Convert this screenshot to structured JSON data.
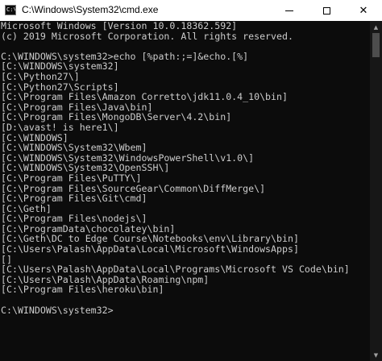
{
  "window": {
    "title": "C:\\Windows\\System32\\cmd.exe",
    "icon_label": "C:\\."
  },
  "controls": {
    "minimize": "minimize-icon",
    "maximize": "maximize-icon",
    "close": "✕"
  },
  "console": {
    "lines": [
      "Microsoft Windows [Version 10.0.18362.592]",
      "(c) 2019 Microsoft Corporation. All rights reserved.",
      "",
      "C:\\WINDOWS\\system32>echo [%path:;=]&echo.[%]",
      "[C:\\WINDOWS\\system32]",
      "[C:\\Python27\\]",
      "[C:\\Python27\\Scripts]",
      "[C:\\Program Files\\Amazon Corretto\\jdk11.0.4_10\\bin]",
      "[C:\\Program Files\\Java\\bin]",
      "[C:\\Program Files\\MongoDB\\Server\\4.2\\bin]",
      "[D:\\avast! is here1\\]",
      "[C:\\WINDOWS]",
      "[C:\\WINDOWS\\System32\\Wbem]",
      "[C:\\WINDOWS\\System32\\WindowsPowerShell\\v1.0\\]",
      "[C:\\WINDOWS\\System32\\OpenSSH\\]",
      "[C:\\Program Files\\PuTTY\\]",
      "[C:\\Program Files\\SourceGear\\Common\\DiffMerge\\]",
      "[C:\\Program Files\\Git\\cmd]",
      "[C:\\Geth]",
      "[C:\\Program Files\\nodejs\\]",
      "[C:\\ProgramData\\chocolatey\\bin]",
      "[C:\\Geth\\DC to Edge Course\\Notebooks\\env\\Library\\bin]",
      "[C:\\Users\\Palash\\AppData\\Local\\Microsoft\\WindowsApps]",
      "[]",
      "[C:\\Users\\Palash\\AppData\\Local\\Programs\\Microsoft VS Code\\bin]",
      "[C:\\Users\\Palash\\AppData\\Roaming\\npm]",
      "[C:\\Program Files\\heroku\\bin]",
      "",
      "C:\\WINDOWS\\system32>"
    ]
  },
  "scrollbar": {
    "up_arrow": "▲",
    "down_arrow": "▼"
  },
  "colors": {
    "console_background": "#0c0c0c",
    "console_text": "#cccccc",
    "titlebar_background": "#ffffff"
  }
}
